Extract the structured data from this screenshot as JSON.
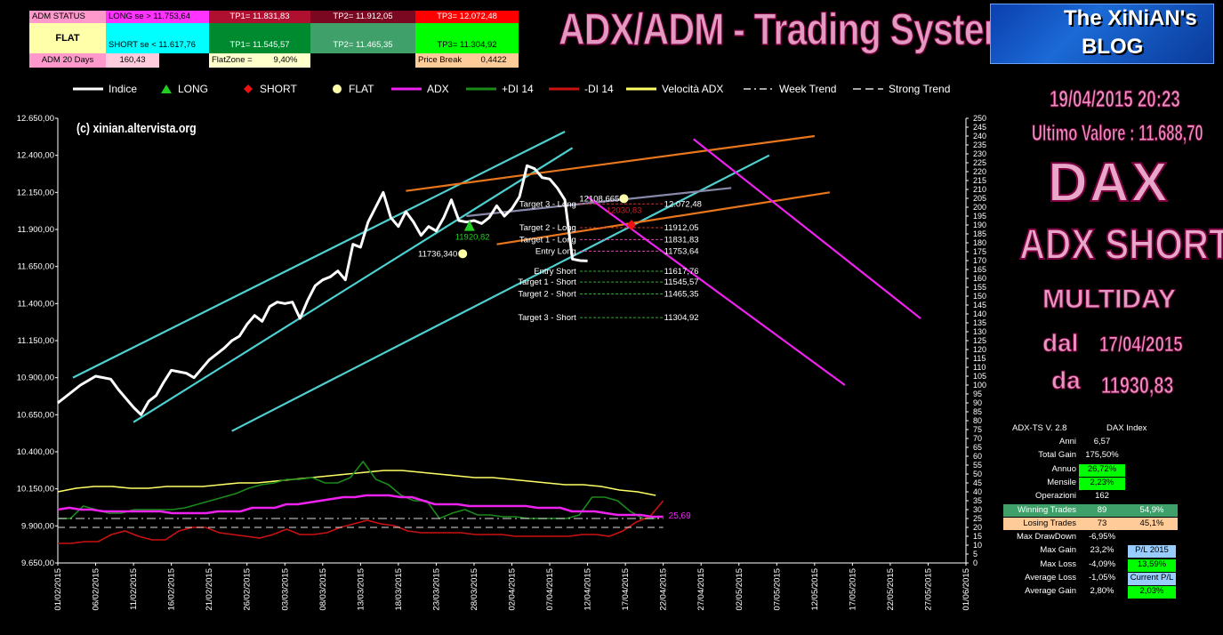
{
  "header_table": {
    "adm_status": "ADM STATUS",
    "long_label": "LONG se > 11.753,64",
    "tp1_long": "TP1=  11.831,83",
    "tp2_long": "TP2=  11.912,05",
    "tp3_long": "TP3=  12.072,48",
    "flat": "FLAT",
    "short_label": "SHORT se < 11.617,76",
    "tp1_short": "TP1=  11.545,57",
    "tp2_short": "TP2=  11.465,35",
    "tp3_short": "TP3=  11.304,92",
    "adm20_label": "ADM 20 Days",
    "adm20_value": "160,43",
    "flatzone_label": "FlatZone =",
    "flatzone_value": "9,40%",
    "pricebreak_label": "Price Break",
    "pricebreak_value": "0,4422"
  },
  "main_title": "ADX/ADM - Trading System V. 2.8",
  "blog": {
    "line1": "The XiNiAN's",
    "line2": "BLOG"
  },
  "watermark": "(c) xinian.altervista.org",
  "legend": [
    {
      "label": "Indice",
      "color": "#ffffff",
      "icon": "line"
    },
    {
      "label": "LONG",
      "color": "#22cc22",
      "icon": "triangle"
    },
    {
      "label": "SHORT",
      "color": "#ee1111",
      "icon": "diamond"
    },
    {
      "label": "FLAT",
      "color": "#ffffaa",
      "icon": "circle"
    },
    {
      "label": "ADX",
      "color": "#ee22ee",
      "icon": "line"
    },
    {
      "label": "+DI 14",
      "color": "#1a8a1a",
      "icon": "line"
    },
    {
      "label": "-DI 14",
      "color": "#cc1111",
      "icon": "line"
    },
    {
      "label": "Velocità ADX",
      "color": "#ffff66",
      "icon": "line"
    },
    {
      "label": "Week Trend",
      "color": "#dddddd",
      "icon": "dashdot"
    },
    {
      "label": "Strong Trend",
      "color": "#dddddd",
      "icon": "dash"
    }
  ],
  "right_panel": {
    "datetime": "19/04/2015 20:23",
    "last_value": "Ultimo Valore :  11.688,70",
    "symbol": "DAX",
    "signal": "ADX SHORT",
    "mode": "MULTIDAY",
    "from_label": "dal",
    "from_date": "17/04/2015",
    "at_label": "da",
    "at_value": "11930,83"
  },
  "stats": {
    "title_left": "ADX-TS V. 2.8",
    "title_right": "DAX Index",
    "rows": [
      {
        "label": "Anni",
        "value": "6,57",
        "extra": ""
      },
      {
        "label": "Total Gain",
        "value": "175,50%",
        "extra": ""
      },
      {
        "label": "Annuo",
        "value": "26,72%",
        "extra": ""
      },
      {
        "label": "Mensile",
        "value": "2,23%",
        "extra": ""
      },
      {
        "label": "Operazioni",
        "value": "162",
        "extra": ""
      },
      {
        "label": "Winning Trades",
        "value": "89",
        "extra": "54,9%"
      },
      {
        "label": "Losing Trades",
        "value": "73",
        "extra": "45,1%"
      },
      {
        "label": "Max DrawDown",
        "value": "-6,95%",
        "extra": ""
      },
      {
        "label": "Max Gain",
        "value": "23,2%",
        "extra": "P/L 2015"
      },
      {
        "label": "Max Loss",
        "value": "-4,09%",
        "extra": "13,59%"
      },
      {
        "label": "Average Loss",
        "value": "-1,05%",
        "extra": "Current P/L"
      },
      {
        "label": "Average Gain",
        "value": "2,80%",
        "extra": "2,03%"
      }
    ]
  },
  "chart_data": {
    "type": "line",
    "y_left": {
      "min": 9650,
      "max": 12650,
      "ticks": [
        "12.650,00",
        "12.400,00",
        "12.150,00",
        "11.900,00",
        "11.650,00",
        "11.400,00",
        "11.150,00",
        "10.900,00",
        "10.650,00",
        "10.400,00",
        "10.150,00",
        "9.900,00",
        "9.650,00"
      ]
    },
    "y_right": {
      "min": 0,
      "max": 250,
      "step": 5
    },
    "x_ticks": [
      "01/02/2015",
      "06/02/2015",
      "11/02/2015",
      "16/02/2015",
      "21/02/2015",
      "26/02/2015",
      "03/03/2015",
      "08/03/2015",
      "13/03/2015",
      "18/03/2015",
      "23/03/2015",
      "28/03/2015",
      "02/04/2015",
      "07/04/2015",
      "12/04/2015",
      "17/04/2015",
      "22/04/2015",
      "27/04/2015",
      "02/05/2015",
      "07/05/2015",
      "12/05/2015",
      "17/05/2015",
      "22/05/2015",
      "27/05/2015",
      "01/06/2015"
    ],
    "x_day_range": [
      0,
      120
    ],
    "index": {
      "name": "Indice",
      "days": [
        0,
        3,
        5,
        7,
        8,
        9,
        10,
        11,
        12,
        13,
        14,
        15,
        16,
        17,
        18,
        19,
        20,
        21,
        22,
        23,
        24,
        25,
        26,
        27,
        28,
        29,
        30,
        31,
        32,
        33,
        34,
        35,
        36,
        37,
        38,
        39,
        40,
        41,
        42,
        43,
        44,
        45,
        46,
        47,
        48,
        49,
        50,
        51,
        52,
        53,
        54,
        55,
        56,
        57,
        58,
        59,
        60,
        61,
        62,
        63,
        64,
        65,
        66,
        67,
        68,
        69,
        70,
        71,
        72,
        73,
        74,
        75,
        76
      ],
      "values": [
        10730,
        10850,
        10910,
        10890,
        10820,
        10760,
        10700,
        10650,
        10740,
        10780,
        10870,
        10950,
        10940,
        10930,
        10900,
        10960,
        11020,
        11060,
        11100,
        11150,
        11180,
        11260,
        11320,
        11280,
        11380,
        11410,
        11400,
        11410,
        11300,
        11420,
        11520,
        11560,
        11580,
        11620,
        11560,
        11800,
        11780,
        11950,
        12050,
        12150,
        11980,
        11920,
        12020,
        11950,
        11860,
        11920,
        11890,
        11980,
        12100,
        11960,
        11950,
        11960,
        11940,
        11980,
        12060,
        11990,
        12040,
        12120,
        12330,
        12310,
        12250,
        12240,
        12180,
        12100,
        11700,
        11690,
        11688
      ]
    },
    "adx": {
      "name": "ADX",
      "values_approx": [
        30,
        31,
        30,
        30,
        29,
        29,
        29,
        29,
        29,
        29,
        28,
        28,
        28,
        28,
        29,
        29,
        29,
        31,
        31,
        31,
        33,
        33,
        34,
        35,
        36,
        37,
        37,
        38,
        38,
        38,
        37,
        37,
        35,
        33,
        33,
        33,
        32,
        32,
        32,
        32,
        32,
        32,
        31,
        31,
        31,
        29,
        29,
        29,
        28,
        27,
        27,
        27,
        26,
        26
      ]
    },
    "pdi": {
      "name": "+DI 14",
      "values_approx": [
        25,
        25,
        32,
        30,
        28,
        28,
        30,
        30,
        30,
        30,
        31,
        33,
        35,
        37,
        39,
        42,
        44,
        45,
        47,
        47,
        48,
        45,
        45,
        48,
        57,
        47,
        44,
        38,
        35,
        35,
        25,
        28,
        30,
        27,
        27,
        26,
        26,
        25,
        25,
        25,
        25,
        27,
        37,
        37,
        35,
        29,
        25,
        25
      ]
    },
    "mdi": {
      "name": "-DI 14",
      "values_approx": [
        11,
        11,
        12,
        12,
        16,
        18,
        15,
        13,
        13,
        18,
        20,
        20,
        17,
        16,
        15,
        14,
        16,
        19,
        16,
        16,
        17,
        20,
        22,
        24,
        22,
        21,
        18,
        17,
        17,
        17,
        17,
        16,
        16,
        16,
        15,
        15,
        15,
        15,
        15,
        16,
        16,
        15,
        18,
        23,
        26,
        35
      ]
    },
    "vel": {
      "name": "Velocità ADX",
      "values_approx": [
        40,
        42,
        43,
        43,
        42,
        42,
        43,
        43,
        43,
        44,
        45,
        45,
        46,
        47,
        48,
        49,
        50,
        51,
        52,
        52,
        51,
        50,
        49,
        48,
        48,
        47,
        46,
        45,
        44,
        44,
        43,
        41,
        40,
        38
      ]
    },
    "adx_last_label": "25,69",
    "annotations": [
      {
        "text": "Target 3 - Long",
        "value": "12.072,48"
      },
      {
        "text": "Target 2 - Long",
        "value": "11912,05"
      },
      {
        "text": "Target 1 - Long",
        "value": "11831,83"
      },
      {
        "text": "Entry Long",
        "value": "11753,64"
      },
      {
        "text": "Entry Short",
        "value": "11617,76"
      },
      {
        "text": "Target 1 - Short",
        "value": "11545,57"
      },
      {
        "text": "Target 2 - Short",
        "value": "11465,35"
      },
      {
        "text": "Target 3 - Short",
        "value": "11304,92"
      }
    ],
    "point_labels": [
      {
        "text": "11736,340",
        "kind": "flat"
      },
      {
        "text": "11920,82",
        "kind": "long"
      },
      {
        "text": "12108,665",
        "kind": "flat"
      },
      {
        "text": "12030,83",
        "kind": "short"
      }
    ]
  }
}
